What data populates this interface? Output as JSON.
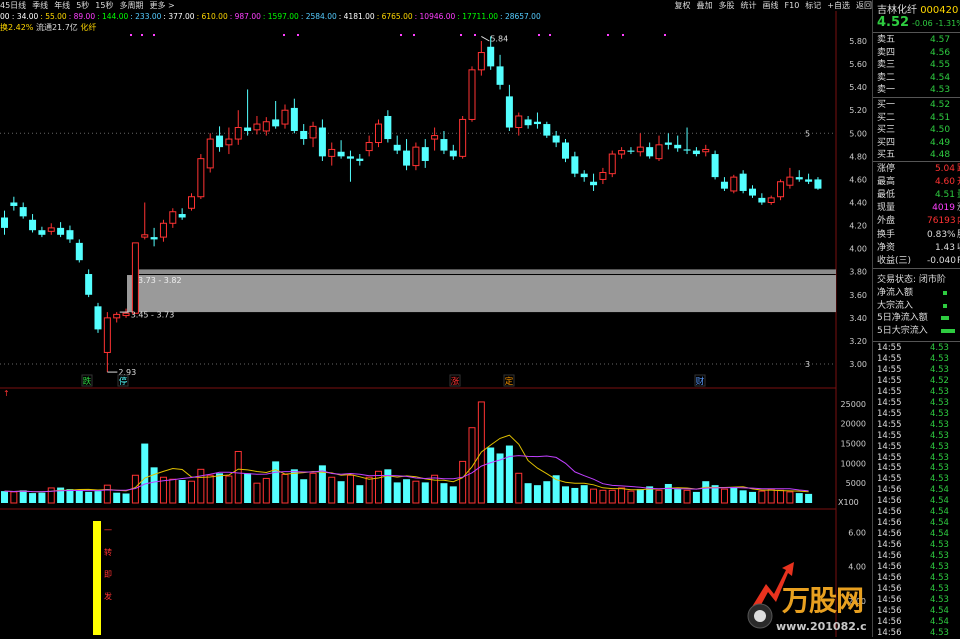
{
  "toolbar": {
    "left_items": [
      "45日线",
      "季线",
      "年线",
      "5秒",
      "15秒",
      "多周期",
      "更多 >"
    ],
    "right_items": [
      "复权",
      "叠加",
      "多股",
      "统计",
      "画线",
      "F10",
      "标记",
      "+自选",
      "返回"
    ]
  },
  "ma_legend": [
    "00 : 34.00",
    ": 55.00",
    ": 89.00",
    ": 144.00",
    ": 233.00",
    ": 377.00",
    ": 610.00",
    ": 987.00",
    ": 1597.00",
    ": 2584.00",
    ": 4181.00",
    ": 6765.00",
    ": 10946.00",
    ": 17711.00",
    ": 28657.00"
  ],
  "stock_info": {
    "prefix": "换2.42%",
    "float": "流通21.7亿",
    "name_tag": "化纤"
  },
  "header": {
    "name": "吉林化纤",
    "code": "000420",
    "price": "4.52",
    "change": "-0.06",
    "change_pct": "-1.31%"
  },
  "order_book": {
    "sells": [
      {
        "label": "卖五",
        "price": "4.57"
      },
      {
        "label": "卖四",
        "price": "4.56"
      },
      {
        "label": "卖三",
        "price": "4.55"
      },
      {
        "label": "卖二",
        "price": "4.54"
      },
      {
        "label": "卖一",
        "price": "4.53"
      }
    ],
    "buys": [
      {
        "label": "买一",
        "price": "4.52"
      },
      {
        "label": "买二",
        "price": "4.51"
      },
      {
        "label": "买三",
        "price": "4.50"
      },
      {
        "label": "买四",
        "price": "4.49"
      },
      {
        "label": "买五",
        "price": "4.48"
      }
    ]
  },
  "stats": [
    {
      "label": "涨停",
      "value": "5.04",
      "color": "red",
      "suffix": "跌"
    },
    {
      "label": "最高",
      "value": "4.60",
      "color": "red",
      "suffix": "开"
    },
    {
      "label": "最低",
      "value": "4.51",
      "color": "green",
      "suffix": "量"
    },
    {
      "label": "现量",
      "value": "4019",
      "color": "magenta",
      "suffix": "涨"
    },
    {
      "label": "外盘",
      "value": "76193",
      "color": "red",
      "suffix": "内"
    },
    {
      "label": "换手",
      "value": "0.83%",
      "color": "white",
      "suffix": "股"
    },
    {
      "label": "净资",
      "value": "1.43",
      "color": "white",
      "suffix": "收"
    },
    {
      "label": "收益(三)",
      "value": "-0.040",
      "color": "white",
      "suffix": "P"
    }
  ],
  "trade_status": "交易状态: 闭市阶",
  "flows": [
    {
      "label": "净流入额"
    },
    {
      "label": "大宗流入"
    },
    {
      "label": "5日净流入额"
    },
    {
      "label": "5日大宗流入"
    }
  ],
  "ticks": [
    {
      "time": "14:55",
      "price": "4.53",
      "color": "green"
    },
    {
      "time": "14:55",
      "price": "4.53",
      "color": "green"
    },
    {
      "time": "14:55",
      "price": "4.53",
      "color": "green"
    },
    {
      "time": "14:55",
      "price": "4.52",
      "color": "green"
    },
    {
      "time": "14:55",
      "price": "4.53",
      "color": "green"
    },
    {
      "time": "14:55",
      "price": "4.53",
      "color": "green"
    },
    {
      "time": "14:55",
      "price": "4.53",
      "color": "green"
    },
    {
      "time": "14:55",
      "price": "4.53",
      "color": "green"
    },
    {
      "time": "14:55",
      "price": "4.53",
      "color": "green"
    },
    {
      "time": "14:55",
      "price": "4.53",
      "color": "green"
    },
    {
      "time": "14:55",
      "price": "4.53",
      "color": "green"
    },
    {
      "time": "14:55",
      "price": "4.53",
      "color": "green"
    },
    {
      "time": "14:55",
      "price": "4.53",
      "color": "green"
    },
    {
      "time": "14:56",
      "price": "4.54",
      "color": "green"
    },
    {
      "time": "14:56",
      "price": "4.54",
      "color": "green"
    },
    {
      "time": "14:56",
      "price": "4.54",
      "color": "green"
    },
    {
      "time": "14:56",
      "price": "4.54",
      "color": "green"
    },
    {
      "time": "14:56",
      "price": "4.54",
      "color": "green"
    },
    {
      "time": "14:56",
      "price": "4.53",
      "color": "green"
    },
    {
      "time": "14:56",
      "price": "4.53",
      "color": "green"
    },
    {
      "time": "14:56",
      "price": "4.53",
      "color": "green"
    },
    {
      "time": "14:56",
      "price": "4.53",
      "color": "green"
    },
    {
      "time": "14:56",
      "price": "4.53",
      "color": "green"
    },
    {
      "time": "14:56",
      "price": "4.53",
      "color": "green"
    },
    {
      "time": "14:56",
      "price": "4.54",
      "color": "green"
    },
    {
      "time": "14:56",
      "price": "4.54",
      "color": "green"
    },
    {
      "time": "14:56",
      "price": "4.53",
      "color": "green"
    }
  ],
  "chart_data": {
    "type": "candlestick",
    "price_axis": {
      "ticks": [
        "5.80",
        "5.60",
        "5.40",
        "5.20",
        "5.00",
        "4.80",
        "4.60",
        "4.40",
        "4.20",
        "4.00",
        "3.80",
        "3.60",
        "3.40",
        "3.20",
        "3.00"
      ],
      "ylim": [
        2.95,
        5.85
      ]
    },
    "volume_axis": {
      "ticks": [
        "25000",
        "20000",
        "15000",
        "10000",
        "5000"
      ],
      "unit": "X100"
    },
    "indicator_axis": {
      "ticks": [
        "6.00",
        "4.00",
        "2.00"
      ]
    },
    "candles": [
      {
        "o": 4.27,
        "h": 4.33,
        "l": 4.12,
        "c": 4.18
      },
      {
        "o": 4.4,
        "h": 4.45,
        "l": 4.33,
        "c": 4.37
      },
      {
        "o": 4.36,
        "h": 4.4,
        "l": 4.26,
        "c": 4.28
      },
      {
        "o": 4.25,
        "h": 4.3,
        "l": 4.14,
        "c": 4.16
      },
      {
        "o": 4.16,
        "h": 4.19,
        "l": 4.1,
        "c": 4.12
      },
      {
        "o": 4.15,
        "h": 4.22,
        "l": 4.12,
        "c": 4.18
      },
      {
        "o": 4.18,
        "h": 4.23,
        "l": 4.1,
        "c": 4.12
      },
      {
        "o": 4.16,
        "h": 4.2,
        "l": 4.05,
        "c": 4.08
      },
      {
        "o": 4.05,
        "h": 4.08,
        "l": 3.88,
        "c": 3.9
      },
      {
        "o": 3.78,
        "h": 3.82,
        "l": 3.58,
        "c": 3.6
      },
      {
        "o": 3.5,
        "h": 3.53,
        "l": 3.27,
        "c": 3.3
      },
      {
        "o": 3.1,
        "h": 3.45,
        "l": 2.93,
        "c": 3.4
      },
      {
        "o": 3.4,
        "h": 3.45,
        "l": 3.36,
        "c": 3.43
      },
      {
        "o": 3.42,
        "h": 3.48,
        "l": 3.4,
        "c": 3.44
      },
      {
        "o": 3.44,
        "h": 4.05,
        "l": 3.44,
        "c": 4.05
      },
      {
        "o": 4.1,
        "h": 4.4,
        "l": 4.08,
        "c": 4.12
      },
      {
        "o": 4.1,
        "h": 4.18,
        "l": 4.02,
        "c": 4.08
      },
      {
        "o": 4.1,
        "h": 4.25,
        "l": 4.06,
        "c": 4.22
      },
      {
        "o": 4.22,
        "h": 4.35,
        "l": 4.18,
        "c": 4.32
      },
      {
        "o": 4.3,
        "h": 4.35,
        "l": 4.25,
        "c": 4.27
      },
      {
        "o": 4.35,
        "h": 4.48,
        "l": 4.33,
        "c": 4.45
      },
      {
        "o": 4.45,
        "h": 4.82,
        "l": 4.43,
        "c": 4.78
      },
      {
        "o": 4.7,
        "h": 5.0,
        "l": 4.66,
        "c": 4.95
      },
      {
        "o": 4.98,
        "h": 5.06,
        "l": 4.84,
        "c": 4.88
      },
      {
        "o": 4.9,
        "h": 5.05,
        "l": 4.82,
        "c": 4.95
      },
      {
        "o": 4.95,
        "h": 5.2,
        "l": 4.9,
        "c": 5.05
      },
      {
        "o": 5.05,
        "h": 5.38,
        "l": 4.98,
        "c": 5.02
      },
      {
        "o": 5.03,
        "h": 5.15,
        "l": 4.99,
        "c": 5.08
      },
      {
        "o": 5.02,
        "h": 5.14,
        "l": 4.98,
        "c": 5.1
      },
      {
        "o": 5.12,
        "h": 5.28,
        "l": 5.04,
        "c": 5.06
      },
      {
        "o": 5.08,
        "h": 5.25,
        "l": 5.04,
        "c": 5.2
      },
      {
        "o": 5.22,
        "h": 5.3,
        "l": 5.0,
        "c": 5.02
      },
      {
        "o": 5.02,
        "h": 5.08,
        "l": 4.9,
        "c": 4.95
      },
      {
        "o": 4.96,
        "h": 5.1,
        "l": 4.88,
        "c": 5.06
      },
      {
        "o": 5.05,
        "h": 5.12,
        "l": 4.76,
        "c": 4.8
      },
      {
        "o": 4.8,
        "h": 4.92,
        "l": 4.72,
        "c": 4.86
      },
      {
        "o": 4.84,
        "h": 4.94,
        "l": 4.78,
        "c": 4.8
      },
      {
        "o": 4.8,
        "h": 4.85,
        "l": 4.58,
        "c": 4.78
      },
      {
        "o": 4.78,
        "h": 4.82,
        "l": 4.72,
        "c": 4.76
      },
      {
        "o": 4.85,
        "h": 4.98,
        "l": 4.8,
        "c": 4.92
      },
      {
        "o": 4.92,
        "h": 5.12,
        "l": 4.88,
        "c": 5.08
      },
      {
        "o": 5.15,
        "h": 5.2,
        "l": 4.92,
        "c": 4.95
      },
      {
        "o": 4.9,
        "h": 4.98,
        "l": 4.82,
        "c": 4.85
      },
      {
        "o": 4.85,
        "h": 4.95,
        "l": 4.68,
        "c": 4.72
      },
      {
        "o": 4.72,
        "h": 4.92,
        "l": 4.68,
        "c": 4.88
      },
      {
        "o": 4.88,
        "h": 4.95,
        "l": 4.7,
        "c": 4.76
      },
      {
        "o": 4.95,
        "h": 5.05,
        "l": 4.85,
        "c": 4.98
      },
      {
        "o": 4.95,
        "h": 5.02,
        "l": 4.82,
        "c": 4.85
      },
      {
        "o": 4.85,
        "h": 4.9,
        "l": 4.77,
        "c": 4.8
      },
      {
        "o": 4.8,
        "h": 5.15,
        "l": 4.78,
        "c": 5.12
      },
      {
        "o": 5.12,
        "h": 5.58,
        "l": 5.1,
        "c": 5.55
      },
      {
        "o": 5.55,
        "h": 5.8,
        "l": 5.5,
        "c": 5.7
      },
      {
        "o": 5.75,
        "h": 5.84,
        "l": 5.55,
        "c": 5.58
      },
      {
        "o": 5.58,
        "h": 5.68,
        "l": 5.38,
        "c": 5.42
      },
      {
        "o": 5.32,
        "h": 5.42,
        "l": 5.02,
        "c": 5.05
      },
      {
        "o": 5.05,
        "h": 5.18,
        "l": 4.98,
        "c": 5.15
      },
      {
        "o": 5.12,
        "h": 5.15,
        "l": 5.04,
        "c": 5.07
      },
      {
        "o": 5.1,
        "h": 5.18,
        "l": 5.04,
        "c": 5.08
      },
      {
        "o": 5.08,
        "h": 5.1,
        "l": 4.96,
        "c": 4.98
      },
      {
        "o": 4.98,
        "h": 5.02,
        "l": 4.88,
        "c": 4.92
      },
      {
        "o": 4.92,
        "h": 4.95,
        "l": 4.75,
        "c": 4.78
      },
      {
        "o": 4.8,
        "h": 4.84,
        "l": 4.62,
        "c": 4.65
      },
      {
        "o": 4.65,
        "h": 4.68,
        "l": 4.58,
        "c": 4.62
      },
      {
        "o": 4.58,
        "h": 4.65,
        "l": 4.5,
        "c": 4.55
      },
      {
        "o": 4.6,
        "h": 4.7,
        "l": 4.56,
        "c": 4.66
      },
      {
        "o": 4.65,
        "h": 4.85,
        "l": 4.62,
        "c": 4.82
      },
      {
        "o": 4.82,
        "h": 4.88,
        "l": 4.78,
        "c": 4.85
      },
      {
        "o": 4.85,
        "h": 4.88,
        "l": 4.82,
        "c": 4.84
      },
      {
        "o": 4.84,
        "h": 5.0,
        "l": 4.8,
        "c": 4.88
      },
      {
        "o": 4.88,
        "h": 4.92,
        "l": 4.78,
        "c": 4.8
      },
      {
        "o": 4.78,
        "h": 4.98,
        "l": 4.76,
        "c": 4.9
      },
      {
        "o": 4.92,
        "h": 5.0,
        "l": 4.86,
        "c": 4.9
      },
      {
        "o": 4.9,
        "h": 4.98,
        "l": 4.84,
        "c": 4.87
      },
      {
        "o": 4.86,
        "h": 5.05,
        "l": 4.82,
        "c": 4.85
      },
      {
        "o": 4.85,
        "h": 4.88,
        "l": 4.8,
        "c": 4.82
      },
      {
        "o": 4.84,
        "h": 4.9,
        "l": 4.8,
        "c": 4.86
      },
      {
        "o": 4.82,
        "h": 4.85,
        "l": 4.6,
        "c": 4.62
      },
      {
        "o": 4.58,
        "h": 4.62,
        "l": 4.5,
        "c": 4.52
      },
      {
        "o": 4.5,
        "h": 4.64,
        "l": 4.48,
        "c": 4.62
      },
      {
        "o": 4.65,
        "h": 4.68,
        "l": 4.48,
        "c": 4.5
      },
      {
        "o": 4.52,
        "h": 4.55,
        "l": 4.44,
        "c": 4.46
      },
      {
        "o": 4.44,
        "h": 4.48,
        "l": 4.38,
        "c": 4.4
      },
      {
        "o": 4.4,
        "h": 4.46,
        "l": 4.38,
        "c": 4.44
      },
      {
        "o": 4.45,
        "h": 4.6,
        "l": 4.42,
        "c": 4.58
      },
      {
        "o": 4.55,
        "h": 4.7,
        "l": 4.52,
        "c": 4.62
      },
      {
        "o": 4.62,
        "h": 4.68,
        "l": 4.58,
        "c": 4.6
      },
      {
        "o": 4.6,
        "h": 4.65,
        "l": 4.56,
        "c": 4.58
      },
      {
        "o": 4.6,
        "h": 4.62,
        "l": 4.51,
        "c": 4.52
      }
    ],
    "volumes": [
      {
        "v": 3000,
        "up": false
      },
      {
        "v": 2800,
        "up": true
      },
      {
        "v": 3200,
        "up": false
      },
      {
        "v": 2500,
        "up": false
      },
      {
        "v": 2600,
        "up": false
      },
      {
        "v": 3800,
        "up": true
      },
      {
        "v": 3900,
        "up": false
      },
      {
        "v": 3500,
        "up": false
      },
      {
        "v": 3200,
        "up": false
      },
      {
        "v": 2800,
        "up": false
      },
      {
        "v": 3000,
        "up": false
      },
      {
        "v": 4500,
        "up": true
      },
      {
        "v": 2600,
        "up": false
      },
      {
        "v": 2400,
        "up": false
      },
      {
        "v": 7000,
        "up": true
      },
      {
        "v": 15000,
        "up": false
      },
      {
        "v": 9000,
        "up": false
      },
      {
        "v": 6500,
        "up": true
      },
      {
        "v": 6000,
        "up": true
      },
      {
        "v": 5800,
        "up": false
      },
      {
        "v": 5500,
        "up": true
      },
      {
        "v": 8500,
        "up": true
      },
      {
        "v": 7000,
        "up": true
      },
      {
        "v": 7500,
        "up": false
      },
      {
        "v": 6800,
        "up": true
      },
      {
        "v": 13000,
        "up": true
      },
      {
        "v": 7500,
        "up": false
      },
      {
        "v": 5000,
        "up": true
      },
      {
        "v": 6200,
        "up": true
      },
      {
        "v": 10500,
        "up": false
      },
      {
        "v": 7200,
        "up": true
      },
      {
        "v": 8500,
        "up": false
      },
      {
        "v": 6000,
        "up": false
      },
      {
        "v": 7500,
        "up": true
      },
      {
        "v": 9500,
        "up": false
      },
      {
        "v": 6500,
        "up": true
      },
      {
        "v": 5500,
        "up": false
      },
      {
        "v": 7000,
        "up": true
      },
      {
        "v": 4500,
        "up": false
      },
      {
        "v": 6500,
        "up": true
      },
      {
        "v": 8000,
        "up": true
      },
      {
        "v": 8500,
        "up": false
      },
      {
        "v": 5200,
        "up": false
      },
      {
        "v": 6000,
        "up": false
      },
      {
        "v": 5500,
        "up": true
      },
      {
        "v": 5200,
        "up": false
      },
      {
        "v": 7000,
        "up": true
      },
      {
        "v": 5000,
        "up": false
      },
      {
        "v": 4200,
        "up": false
      },
      {
        "v": 10500,
        "up": true
      },
      {
        "v": 19000,
        "up": true
      },
      {
        "v": 25500,
        "up": true
      },
      {
        "v": 14000,
        "up": false
      },
      {
        "v": 12500,
        "up": false
      },
      {
        "v": 14500,
        "up": false
      },
      {
        "v": 7500,
        "up": true
      },
      {
        "v": 5000,
        "up": false
      },
      {
        "v": 4500,
        "up": false
      },
      {
        "v": 5500,
        "up": false
      },
      {
        "v": 7000,
        "up": false
      },
      {
        "v": 4200,
        "up": false
      },
      {
        "v": 3800,
        "up": false
      },
      {
        "v": 4500,
        "up": false
      },
      {
        "v": 3500,
        "up": true
      },
      {
        "v": 3200,
        "up": true
      },
      {
        "v": 3200,
        "up": true
      },
      {
        "v": 3800,
        "up": true
      },
      {
        "v": 3000,
        "up": true
      },
      {
        "v": 3500,
        "up": false
      },
      {
        "v": 4200,
        "up": false
      },
      {
        "v": 3200,
        "up": true
      },
      {
        "v": 4800,
        "up": false
      },
      {
        "v": 3500,
        "up": false
      },
      {
        "v": 3200,
        "up": true
      },
      {
        "v": 2800,
        "up": false
      },
      {
        "v": 5500,
        "up": false
      },
      {
        "v": 4500,
        "up": false
      },
      {
        "v": 3500,
        "up": true
      },
      {
        "v": 3800,
        "up": false
      },
      {
        "v": 3200,
        "up": false
      },
      {
        "v": 2800,
        "up": false
      },
      {
        "v": 3000,
        "up": true
      },
      {
        "v": 3500,
        "up": true
      },
      {
        "v": 3200,
        "up": true
      },
      {
        "v": 2800,
        "up": true
      },
      {
        "v": 2500,
        "up": false
      },
      {
        "v": 2300,
        "up": false
      }
    ],
    "annotations": [
      {
        "text": "5.84"
      },
      {
        "text": "2.93"
      },
      {
        "text": "3.45 - 3.73"
      },
      {
        "text": "3.73 - 3.82"
      },
      {
        "text": "5",
        "level": 5.0
      },
      {
        "text": "3",
        "level": 3.0
      }
    ],
    "markers": [
      {
        "text": "跌"
      },
      {
        "text": "停"
      },
      {
        "text": "涨"
      },
      {
        "text": "定"
      },
      {
        "text": "财"
      }
    ],
    "zone": {
      "from": 3.45,
      "to": 3.82
    },
    "signal_text": [
      "一",
      "转",
      "即",
      "发"
    ]
  },
  "watermark": {
    "url": "www.201082.com",
    "brand": "万股网"
  }
}
